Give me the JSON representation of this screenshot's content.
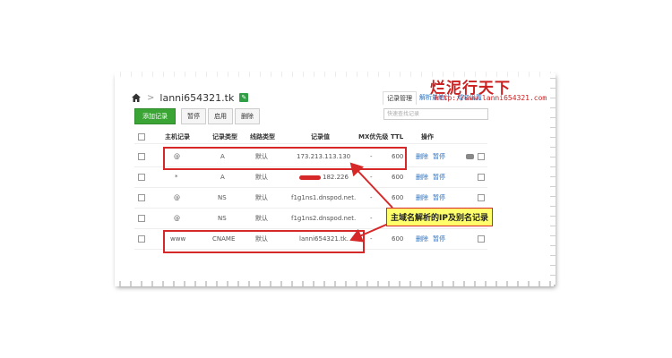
{
  "watermark": {
    "brand": "烂泥行天下",
    "url": "http://www.lanni654321.com"
  },
  "header": {
    "domain": "lanni654321.tk",
    "crumb_sep": ">",
    "badge": "✎"
  },
  "tabs": [
    {
      "label": "记录管理",
      "active": true
    },
    {
      "label": "解析量统计",
      "active": false
    },
    {
      "label": "域名设置",
      "active": false
    }
  ],
  "toolbar": {
    "add": "添加记录",
    "pause": "暂停",
    "enable": "启用",
    "delete": "删除"
  },
  "search": {
    "placeholder": "快速查找记录"
  },
  "table": {
    "headers": [
      "主机记录",
      "记录类型",
      "线路类型",
      "记录值",
      "MX优先级",
      "TTL",
      "操作"
    ],
    "rows": [
      {
        "host": "@",
        "type": "A",
        "line": "默认",
        "value": "173.213.113.130",
        "mx": "-",
        "ttl": "600",
        "op1": "删除",
        "op2": "暂停"
      },
      {
        "host": "*",
        "type": "A",
        "line": "默认",
        "value": "182.226",
        "mx": "-",
        "ttl": "600",
        "op1": "删除",
        "op2": "暂停"
      },
      {
        "host": "@",
        "type": "NS",
        "line": "默认",
        "value": "f1g1ns1.dnspod.net.",
        "mx": "-",
        "ttl": "600",
        "op1": "删除",
        "op2": "暂停"
      },
      {
        "host": "@",
        "type": "NS",
        "line": "默认",
        "value": "f1g1ns2.dnspod.net.",
        "mx": "-",
        "ttl": "600",
        "op1": "删除",
        "op2": "暂停"
      },
      {
        "host": "www",
        "type": "CNAME",
        "line": "默认",
        "value": "lanni654321.tk.",
        "mx": "-",
        "ttl": "600",
        "op1": "删除",
        "op2": "暂停"
      }
    ]
  },
  "annotation": {
    "label": "主域名解析的IP及别名记录",
    "color": "#d62828",
    "fill": "#ffff6b"
  }
}
